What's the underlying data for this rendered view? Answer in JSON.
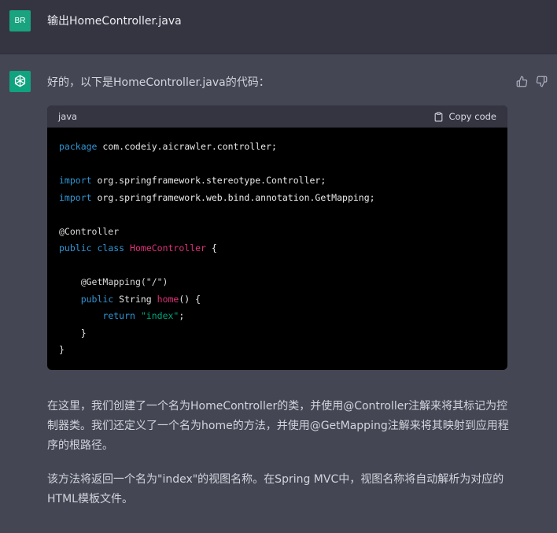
{
  "user_message": {
    "avatar_text": "BR",
    "text": "输出HomeController.java"
  },
  "assistant": {
    "intro": "好的，以下是HomeController.java的代码：",
    "code_block": {
      "language": "java",
      "copy_label": "Copy code",
      "lines": [
        {
          "tokens": [
            {
              "t": "package",
              "c": "kw"
            },
            {
              "t": " com.codeiy.aicrawler.controller;",
              "c": ""
            }
          ]
        },
        {
          "tokens": []
        },
        {
          "tokens": [
            {
              "t": "import",
              "c": "kw"
            },
            {
              "t": " org.springframework.stereotype.Controller;",
              "c": ""
            }
          ]
        },
        {
          "tokens": [
            {
              "t": "import",
              "c": "kw"
            },
            {
              "t": " org.springframework.web.bind.annotation.GetMapping;",
              "c": ""
            }
          ]
        },
        {
          "tokens": []
        },
        {
          "tokens": [
            {
              "t": "@Controller",
              "c": "ann"
            }
          ]
        },
        {
          "tokens": [
            {
              "t": "public",
              "c": "kw"
            },
            {
              "t": " ",
              "c": ""
            },
            {
              "t": "class",
              "c": "kw"
            },
            {
              "t": " ",
              "c": ""
            },
            {
              "t": "HomeController",
              "c": "title"
            },
            {
              "t": " {",
              "c": ""
            }
          ]
        },
        {
          "tokens": []
        },
        {
          "tokens": [
            {
              "t": "    ",
              "c": ""
            },
            {
              "t": "@GetMapping(\"/\")",
              "c": "ann"
            }
          ]
        },
        {
          "tokens": [
            {
              "t": "    ",
              "c": ""
            },
            {
              "t": "public",
              "c": "kw"
            },
            {
              "t": " String ",
              "c": ""
            },
            {
              "t": "home",
              "c": "title"
            },
            {
              "t": "() {",
              "c": ""
            }
          ]
        },
        {
          "tokens": [
            {
              "t": "        ",
              "c": ""
            },
            {
              "t": "return",
              "c": "kw"
            },
            {
              "t": " ",
              "c": ""
            },
            {
              "t": "\"index\"",
              "c": "str"
            },
            {
              "t": ";",
              "c": ""
            }
          ]
        },
        {
          "tokens": [
            {
              "t": "    }",
              "c": ""
            }
          ]
        },
        {
          "tokens": [
            {
              "t": "}",
              "c": ""
            }
          ]
        }
      ]
    },
    "paragraph1": "在这里，我们创建了一个名为HomeController的类，并使用@Controller注解来将其标记为控制器类。我们还定义了一个名为home的方法，并使用@GetMapping注解来将其映射到应用程序的根路径。",
    "paragraph2": "该方法将返回一个名为\"index\"的视图名称。在Spring MVC中，视图名称将自动解析为对应的HTML模板文件。"
  },
  "colors": {
    "page_bg": "#444654",
    "user_row_bg": "#343541",
    "avatar_user": "#19a37f",
    "avatar_bot": "#10a37f",
    "code_bg": "#000000",
    "code_header_bg": "#343541"
  },
  "icons": {
    "bot_avatar": "openai-logo-icon",
    "like": "thumbs-up-icon",
    "dislike": "thumbs-down-icon",
    "copy": "clipboard-icon"
  }
}
